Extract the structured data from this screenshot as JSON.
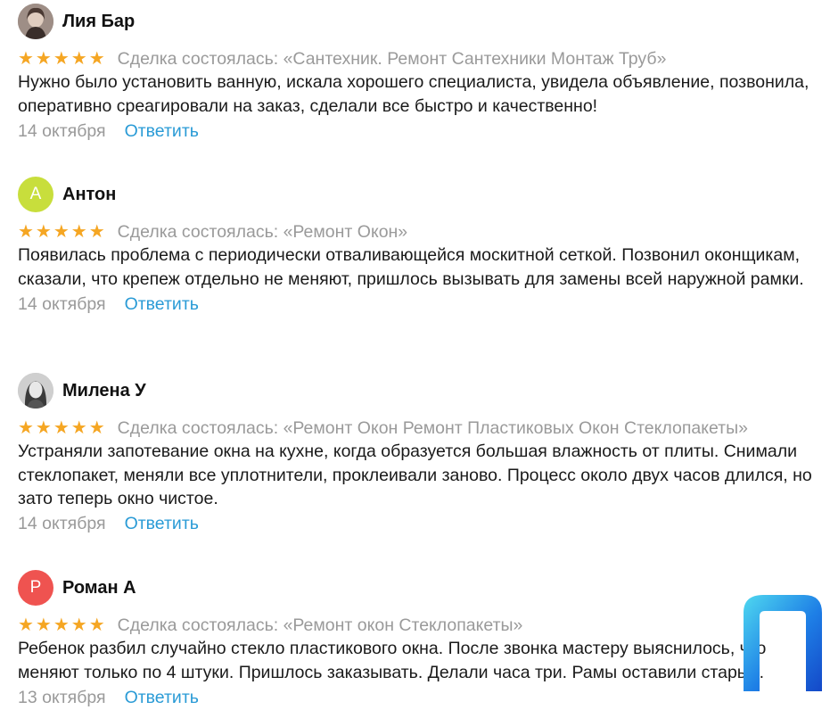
{
  "reviews": [
    {
      "author": "Лия Бар",
      "avatar_letter": "",
      "avatar_type": "photo",
      "rating": "★★★★★",
      "deal": "Сделка состоялась: «Сантехник. Ремонт Сантехники Монтаж Труб»",
      "text": "Нужно было установить ванную, искала хорошего специалиста, увидела объявление, позвонила, оперативно среагировали на заказ, сделали все быстро и качественно!",
      "date": "14 октября",
      "reply": "Ответить"
    },
    {
      "author": "Антон",
      "avatar_letter": "А",
      "avatar_color": "#c8de3c",
      "rating": "★★★★★",
      "deal": "Сделка состоялась: «Ремонт Окон»",
      "text": "Появилась проблема с периодически отваливающейся москитной сеткой. Позвонил оконщикам, сказали, что крепеж отдельно не меняют, пришлось вызывать для замены всей наружной рамки.",
      "date": "14 октября",
      "reply": "Ответить"
    },
    {
      "author": "Милена У",
      "avatar_letter": "",
      "avatar_type": "photo",
      "rating": "★★★★★",
      "deal": "Сделка состоялась: «Ремонт Окон Ремонт Пластиковых Окон Стеклопакеты»",
      "text": "Устраняли запотевание окна на кухне, когда образуется большая влажность от плиты. Снимали стеклопакет, меняли все уплотнители, проклеивали заново. Процесс около двух часов длился, но зато теперь окно чистое.",
      "date": "14 октября",
      "reply": "Ответить"
    },
    {
      "author": "Роман А",
      "avatar_letter": "Р",
      "avatar_color": "#ef5350",
      "rating": "★★★★★",
      "deal": "Сделка состоялась: «Ремонт окон Стеклопакеты»",
      "text": "Ребенок разбил случайно стекло пластикового окна. После звонка мастеру выяснилось, что меняют только по 4 штуки. Пришлось заказывать. Делали часа три. Рамы оставили старые.",
      "date": "13 октября",
      "reply": "Ответить"
    }
  ],
  "colors": {
    "star": "#f5a623",
    "muted": "#9a9a9a",
    "link": "#2a9bd6"
  },
  "watermark_icon": "brand-logo-icon"
}
